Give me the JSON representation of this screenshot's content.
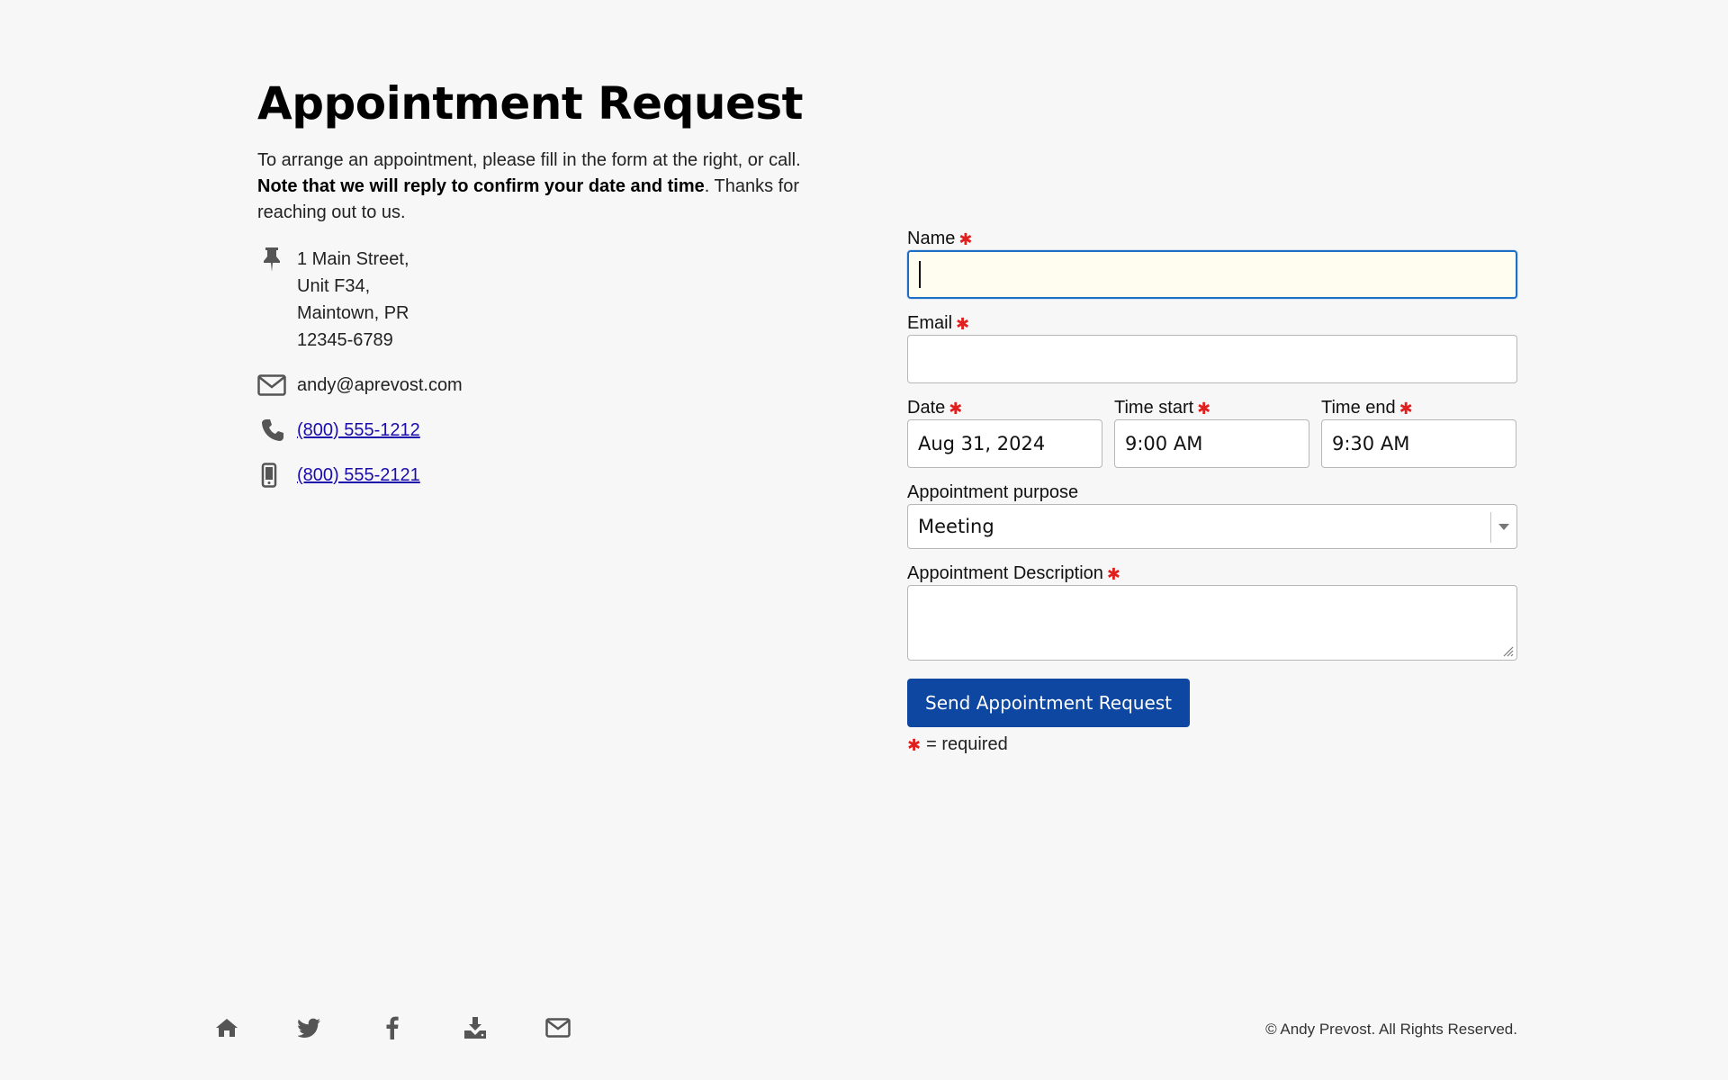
{
  "header": {
    "title": "Appointment Request"
  },
  "intro": {
    "text_before": "To arrange an appointment, please fill in the form at the right, or call. ",
    "bold": "Note that we will reply to confirm your date and time",
    "text_after": ". Thanks for reaching out to us."
  },
  "contact": {
    "address": [
      "1 Main Street,",
      "Unit F34,",
      "Maintown, PR",
      "12345-6789"
    ],
    "email": "andy@aprevost.com",
    "phone": "(800) 555-1212",
    "mobile": "(800) 555-2121",
    "icons": [
      "pin-icon",
      "envelope-icon",
      "phone-icon",
      "mobile-icon"
    ]
  },
  "form": {
    "name": {
      "label": "Name",
      "value": ""
    },
    "email": {
      "label": "Email",
      "value": ""
    },
    "date": {
      "label": "Date",
      "value": "Aug 31, 2024"
    },
    "time_start": {
      "label": "Time start",
      "value": "9:00 AM"
    },
    "time_end": {
      "label": "Time end",
      "value": "9:30 AM"
    },
    "purpose": {
      "label": "Appointment purpose",
      "selected": "Meeting"
    },
    "description": {
      "label": "Appointment Description",
      "value": ""
    },
    "required_mark": "✱",
    "submit_label": "Send Appointment Request",
    "required_legend": "= required"
  },
  "footer": {
    "icons": [
      "home-icon",
      "twitter-icon",
      "facebook-icon",
      "download-icon",
      "envelope-icon"
    ],
    "copyright": "© Andy Prevost. All Rights Reserved."
  },
  "colors": {
    "background": "#f7f7f7",
    "accent": "#0d47a1",
    "required": "#e0201f",
    "link": "#1a0dab",
    "focus_border": "#1e6fc4",
    "focus_bg": "#fffdf0"
  }
}
